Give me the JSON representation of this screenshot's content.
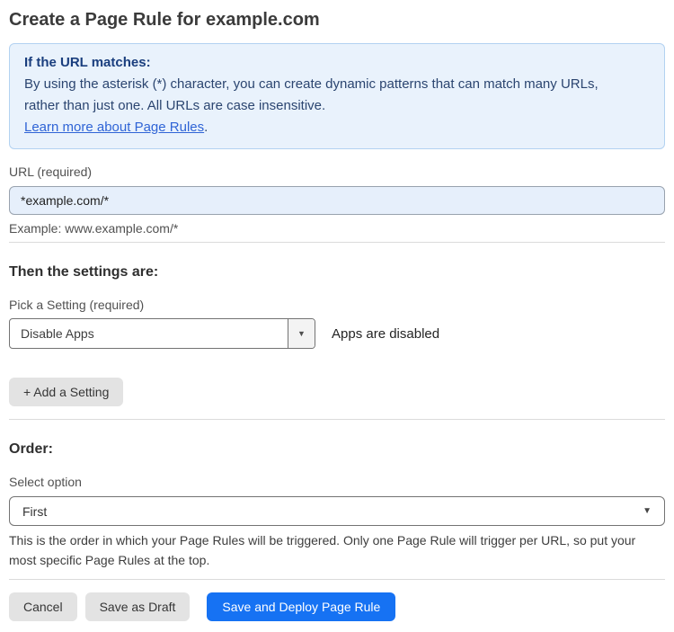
{
  "page": {
    "title": "Create a Page Rule for example.com"
  },
  "info_box": {
    "heading": "If the URL matches:",
    "body_lines": [
      "By using the asterisk (*) character, you can create dynamic patterns that can match many URLs,",
      "rather than just one. All URLs are case insensitive."
    ],
    "link_label": "Learn more about Page Rules",
    "link_suffix": "."
  },
  "url_field": {
    "label": "URL (required)",
    "value": "*example.com/*",
    "helper": "Example: www.example.com/*"
  },
  "settings": {
    "heading": "Then the settings are:",
    "picker_label": "Pick a Setting (required)",
    "selected_setting": "Disable Apps",
    "status_text": "Apps are disabled",
    "add_button_label": "+ Add a Setting"
  },
  "order": {
    "heading": "Order:",
    "select_label": "Select option",
    "selected_option": "First",
    "help_lines": [
      "This is the order in which your Page Rules will be triggered. Only one Page Rule will trigger per URL, so put your",
      "most specific Page Rules at the top."
    ]
  },
  "footer": {
    "cancel_label": "Cancel",
    "save_draft_label": "Save as Draft",
    "save_deploy_label": "Save and Deploy Page Rule"
  },
  "icons": {
    "dropdown_arrow": "▼"
  },
  "colors": {
    "info_box_bg": "#e9f2fc",
    "info_box_border": "#b3d2f1",
    "info_text": "#2b4570",
    "link_blue": "#2f64d6",
    "input_bg": "#e6effb",
    "primary_button_blue": "#1672f3",
    "gray_button_bg": "#e3e3e3"
  }
}
